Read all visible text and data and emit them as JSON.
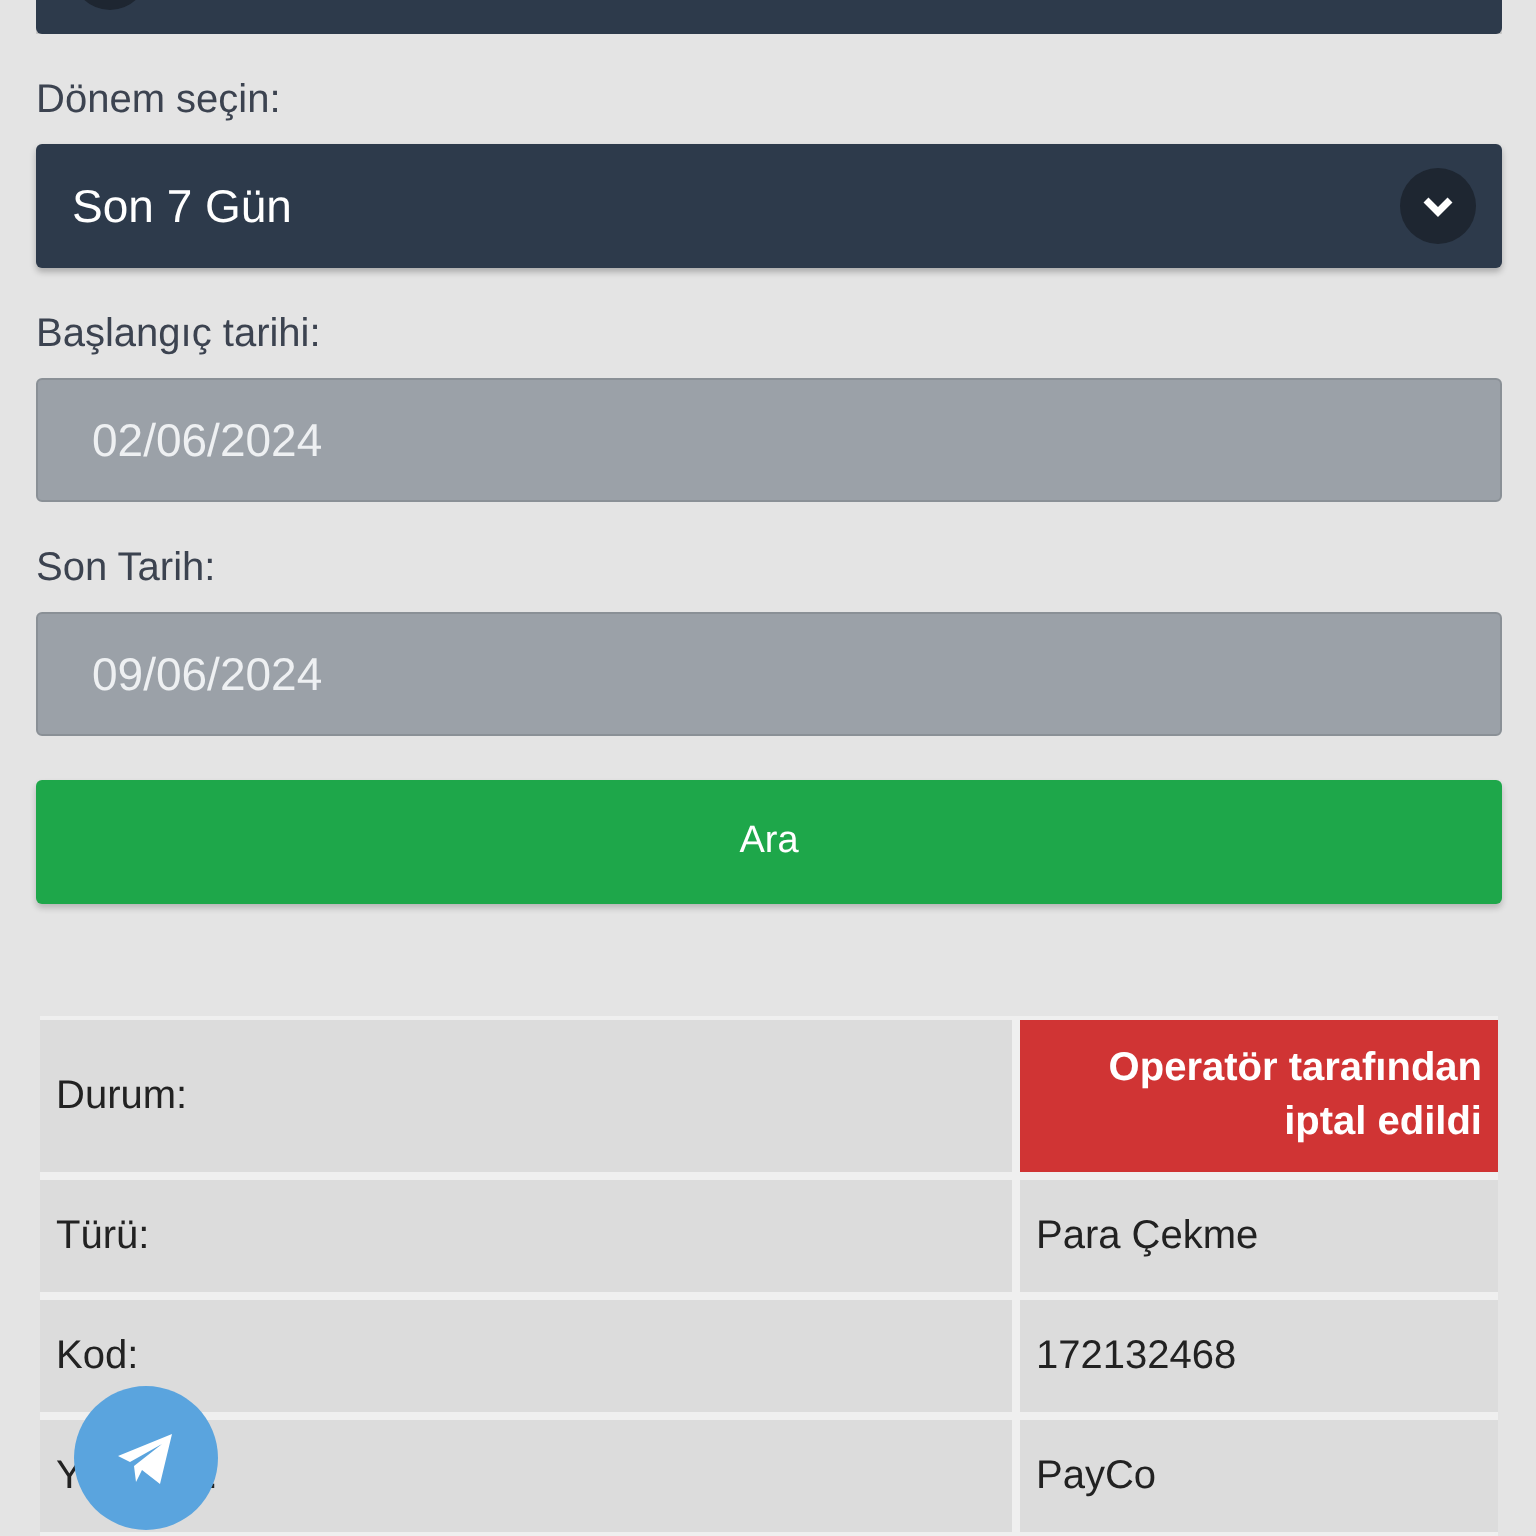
{
  "period": {
    "label": "Dönem seçin:",
    "value": "Son 7 Gün"
  },
  "start_date": {
    "label": "Başlangıç tarihi:",
    "value": "02/06/2024",
    "disabled": true
  },
  "end_date": {
    "label": "Son Tarih:",
    "value": "09/06/2024",
    "disabled": true
  },
  "search_button": "Ara",
  "details": [
    {
      "label": "Durum:",
      "value": "Operatör tarafından iptal edildi",
      "kind": "status"
    },
    {
      "label": "Türü:",
      "value": "Para Çekme",
      "kind": "text"
    },
    {
      "label": "Kod:",
      "value": "172132468",
      "kind": "text"
    },
    {
      "label": "Y",
      "label_end": ".",
      "value": "PayCo",
      "kind": "text"
    }
  ]
}
